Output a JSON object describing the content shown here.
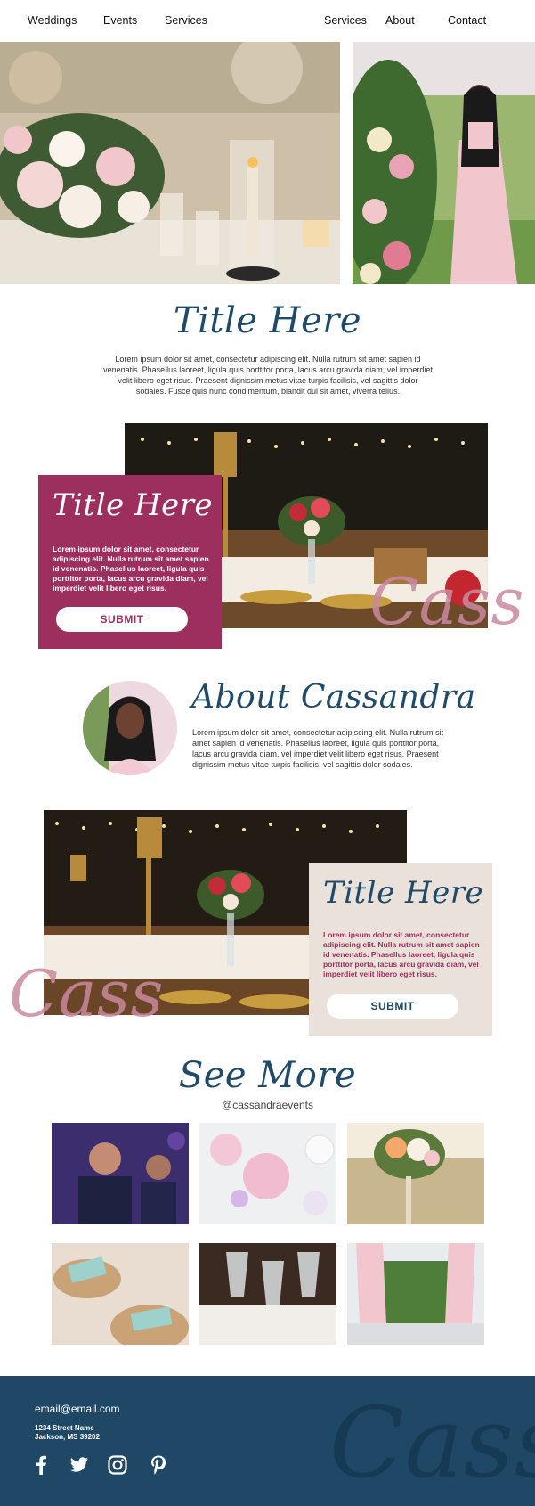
{
  "nav": {
    "left": [
      "Weddings",
      "Events",
      "Services"
    ],
    "right": [
      "Services",
      "About",
      "Contact"
    ]
  },
  "intro": {
    "title": "Title Here",
    "text": "Lorem ipsum dolor sit amet, consectetur adipiscing elit. Nulla rutrum sit amet sapien id venenatis. Phasellus laoreet, ligula quis porttitor porta, lacus arcu gravida diam, vel imperdiet velit libero eget risus. Praesent dignissim metus vitae turpis facilisis, vel sagittis dolor sodales. Fusce quis nunc condimentum, blandit dui sit amet, viverra tellus."
  },
  "feature1": {
    "title": "Title Here",
    "text": "Lorem ipsum dolor sit amet, consectetur adipiscing elit. Nulla rutrum sit amet sapien id venenatis. Phasellus laoreet, ligula quis porttitor porta, lacus arcu gravida diam, vel imperdiet velit libero eget risus.",
    "button": "SUBMIT",
    "watermark": "Cass"
  },
  "about": {
    "title": "About Cassandra",
    "text": "Lorem ipsum dolor sit amet, consectetur adipiscing elit. Nulla rutrum sit amet sapien id venenatis. Phasellus laoreet, ligula quis porttitor porta, lacus arcu gravida diam, vel imperdiet velit libero eget risus. Praesent dignissim metus vitae turpis facilisis, vel sagittis dolor sodales."
  },
  "feature2": {
    "title": "Title Here",
    "text": "Lorem ipsum dolor sit amet, consectetur adipiscing elit. Nulla rutrum sit amet sapien id venenatis. Phasellus laoreet, ligula quis porttitor porta, lacus arcu gravida diam, vel imperdiet velit libero eget risus.",
    "button": "SUBMIT",
    "watermark": "Cass"
  },
  "see_more": {
    "title": "See More",
    "handle": "@cassandraevents"
  },
  "footer": {
    "email": "email@email.com",
    "street": "1234 Street Name",
    "city": "Jackson, MS 39202",
    "watermark": "Cass"
  },
  "colors": {
    "navy": "#1f4a68",
    "plum": "#9c2f5e",
    "blush": "#c9899f",
    "beige": "#eae1da",
    "footer": "#1e4866"
  }
}
